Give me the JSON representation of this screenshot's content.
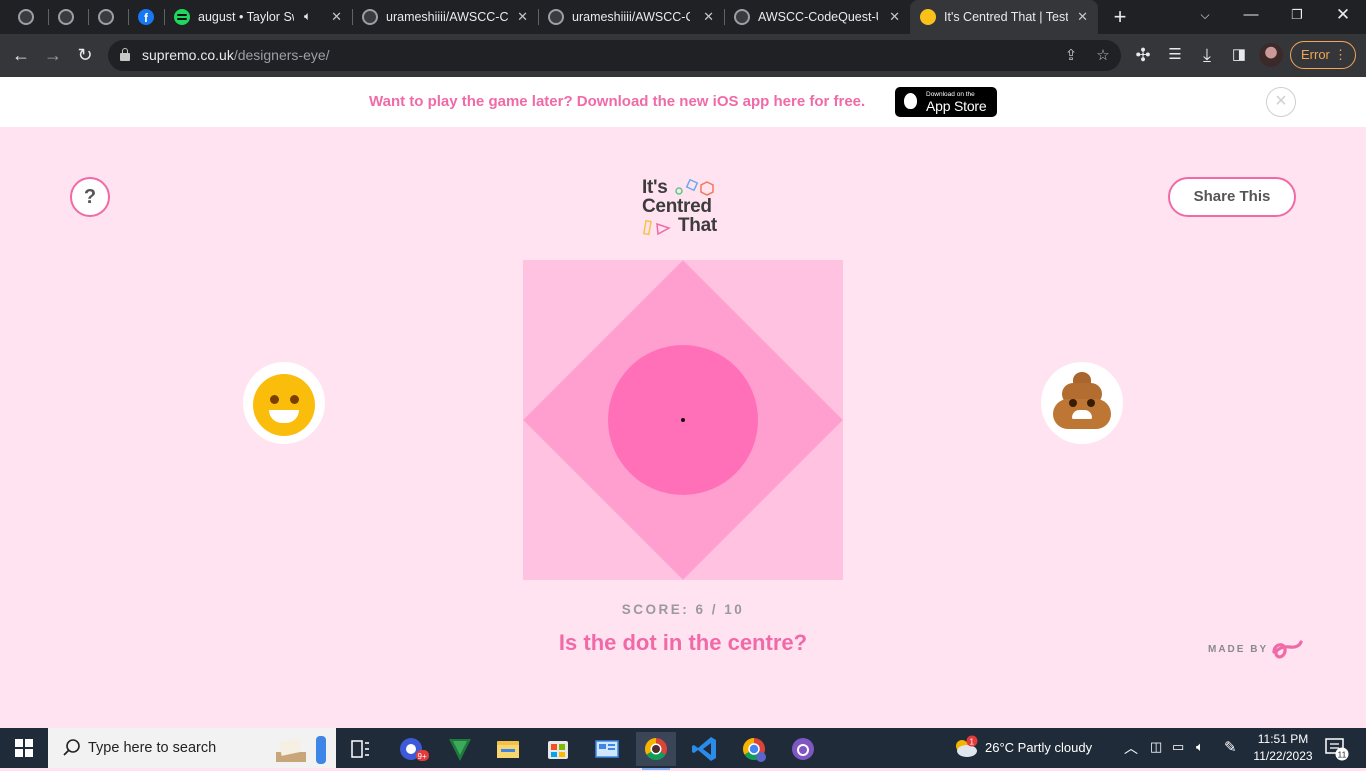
{
  "browser": {
    "tabs": [
      {
        "title": "",
        "icon": "github-icon"
      },
      {
        "title": "",
        "icon": "github-icon"
      },
      {
        "title": "",
        "icon": "facebook-icon"
      },
      {
        "title": "august • Taylor Sw",
        "icon": "spotify-icon",
        "audio": true
      },
      {
        "title": "urameshiiii/AWSCC-Co",
        "icon": "github-icon"
      },
      {
        "title": "urameshiiii/AWSCC-Co",
        "icon": "github-icon"
      },
      {
        "title": "AWSCC-CodeQuest-U",
        "icon": "github-icon"
      },
      {
        "title": "It's Centred That | Test",
        "icon": "smiley-icon",
        "active": true
      }
    ],
    "url_domain": "supremo.co.uk",
    "url_path": "/designers-eye/",
    "error_label": "Error"
  },
  "banner": {
    "text": "Want to play the game later? Download the new iOS app here for free.",
    "appstore_small": "Download on the",
    "appstore_big": "App Store"
  },
  "game": {
    "help_label": "?",
    "share_label": "Share This",
    "logo_lines": [
      "It's",
      "Centred",
      "That"
    ],
    "score_text": "SCORE: 6 / 10",
    "question": "Is the dot in the centre?",
    "made_by": "MADE BY",
    "colors": {
      "background": "#ffe3f1",
      "square": "#ffc2e1",
      "diamond": "#ff9fcf",
      "circle": "#ff70b8",
      "accent": "#f06aa8"
    }
  },
  "taskbar": {
    "search_placeholder": "Type here to search",
    "weather": "26°C  Partly cloudy",
    "weather_badge": "1",
    "time": "11:51 PM",
    "date": "11/22/2023",
    "notifications": "11",
    "store_badge": "9+"
  }
}
